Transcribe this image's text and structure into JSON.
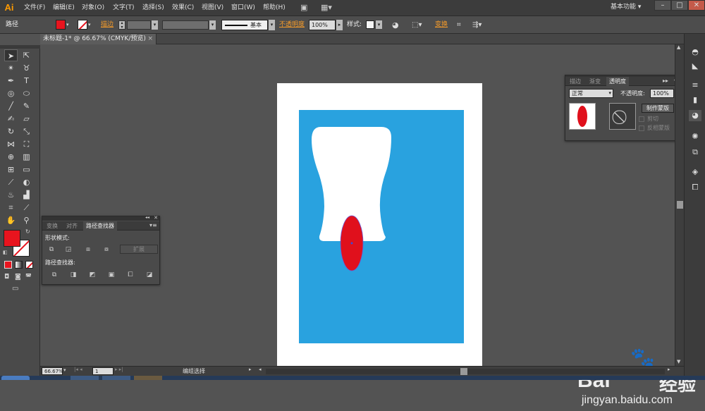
{
  "app": {
    "logo": "Ai"
  },
  "menu": [
    "文件(F)",
    "编辑(E)",
    "对象(O)",
    "文字(T)",
    "选择(S)",
    "效果(C)",
    "视图(V)",
    "窗口(W)",
    "帮助(H)"
  ],
  "workspace": "基本功能",
  "controlbar": {
    "object_label": "路径",
    "fill_color": "#e8141e",
    "stroke_label": "描边",
    "brush_label": "基本",
    "opacity_label": "不透明度",
    "opacity_value": "100%",
    "style_label": "样式",
    "transform_label": "变换"
  },
  "document": {
    "tab_title": "未标题-1* @ 66.67% (CMYK/预览)",
    "close": "×"
  },
  "canvas": {
    "blue_color": "#29a2df",
    "ellipse_color": "#e0101c"
  },
  "transparency_panel": {
    "tabs": [
      "描边",
      "渐变",
      "透明度"
    ],
    "blend_mode": "正常",
    "opacity_label": "不透明度:",
    "opacity_value": "100%",
    "make_mask_button": "制作蒙版",
    "clip_label": "剪切",
    "invert_label": "反相蒙版"
  },
  "pathfinder_panel": {
    "tabs": [
      "变换",
      "对齐",
      "路径查找器"
    ],
    "shape_modes_label": "形状模式:",
    "expand_button": "扩展",
    "pathfinders_label": "路径查找器:"
  },
  "status": {
    "zoom": "66.67%",
    "page": "1",
    "tool": "编组选择"
  },
  "watermark": {
    "brand": "Bai",
    "brand_cn": "经验",
    "url": "jingyan.baidu.com"
  }
}
